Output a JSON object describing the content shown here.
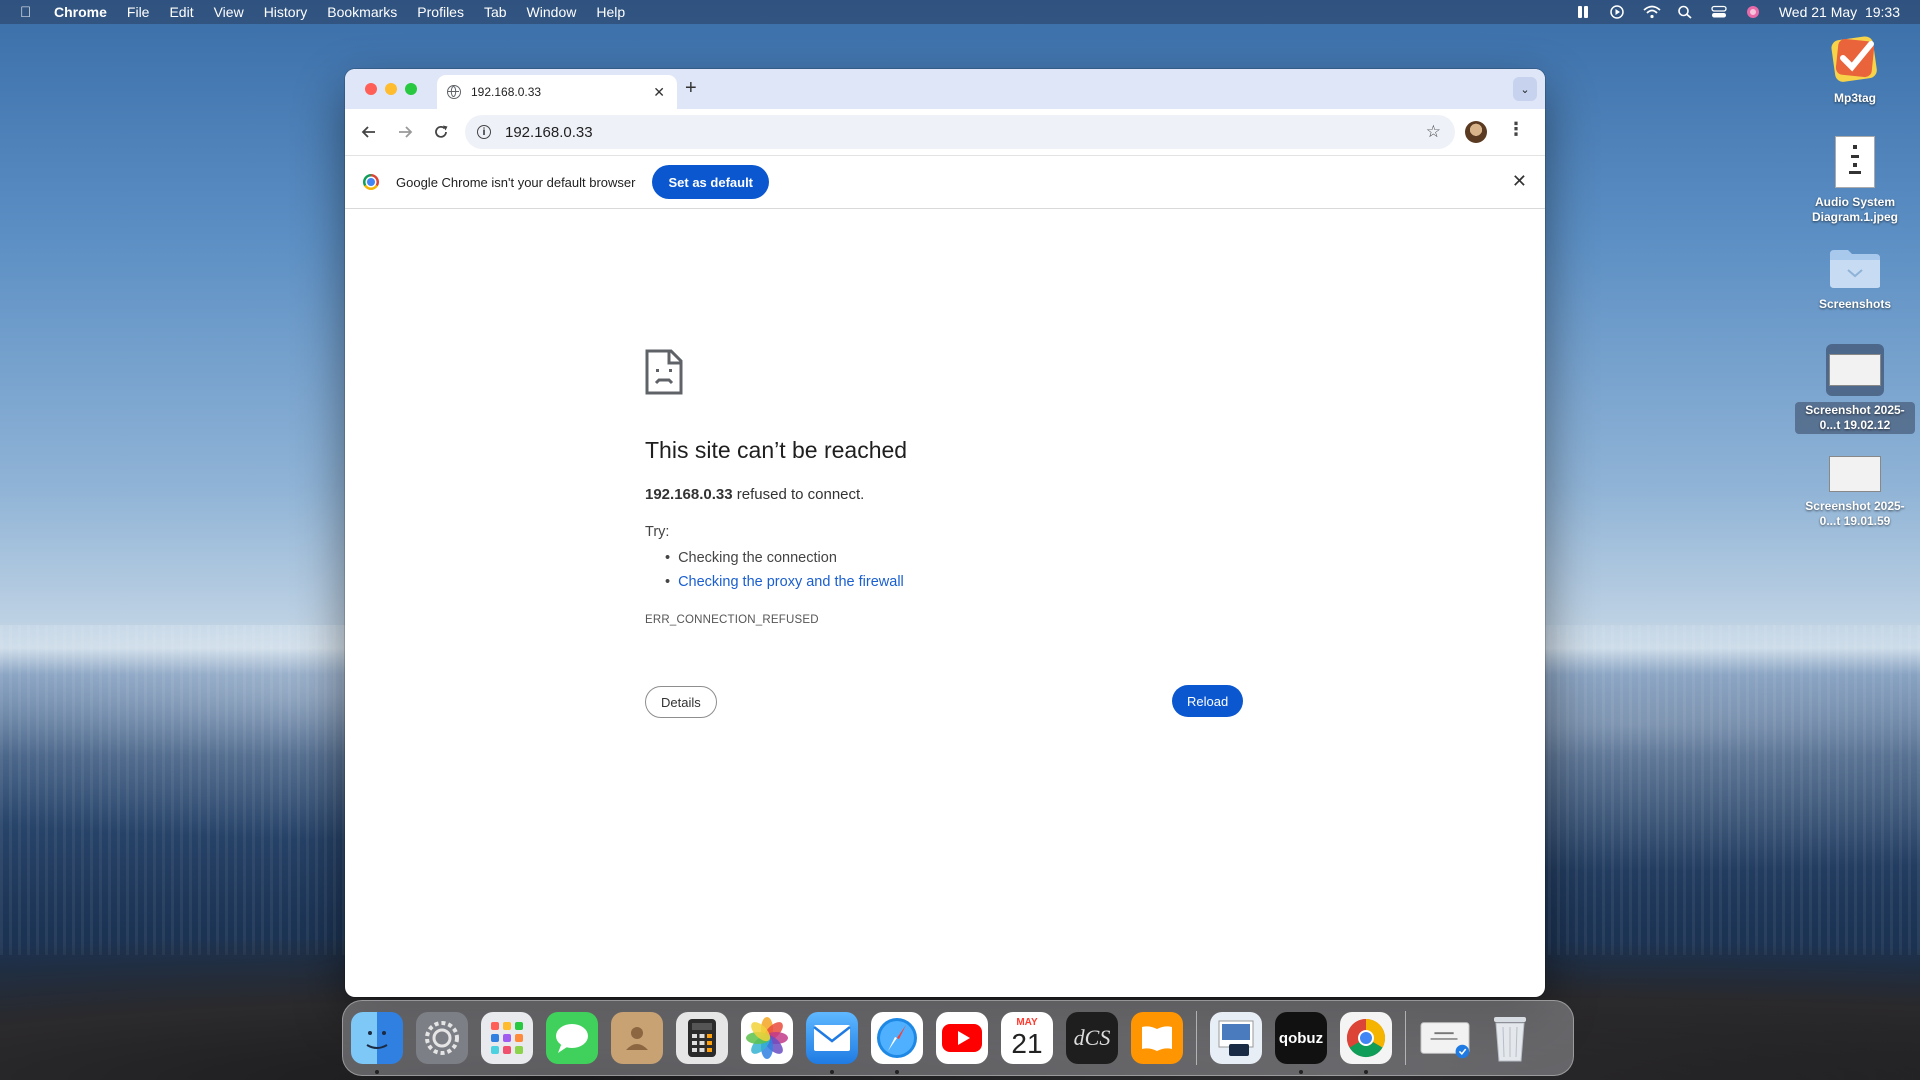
{
  "menubar": {
    "app": "Chrome",
    "items": [
      "File",
      "Edit",
      "View",
      "History",
      "Bookmarks",
      "Profiles",
      "Tab",
      "Window",
      "Help"
    ],
    "clock": "Wed 21 May  19:33"
  },
  "desktop": {
    "items": [
      {
        "label": "Mp3tag",
        "icon": "mp3tag-icon"
      },
      {
        "label": "Audio System Diagram.1.jpeg",
        "icon": "jpeg-file-icon"
      },
      {
        "label": "Screenshots",
        "icon": "folder-icon"
      },
      {
        "label": "Screenshot 2025-0...t 19.02.12",
        "icon": "screenshot-thumbnail"
      },
      {
        "label": "Screenshot 2025-0...t 19.01.59",
        "icon": "screenshot-thumbnail"
      }
    ]
  },
  "browser": {
    "tab_title": "192.168.0.33",
    "url": "192.168.0.33",
    "infobar": {
      "message": "Google Chrome isn't your default browser",
      "button": "Set as default"
    },
    "error": {
      "title": "This site can’t be reached",
      "host": "192.168.0.33",
      "host_suffix": " refused to connect.",
      "try_label": "Try:",
      "suggestions": [
        "Checking the connection",
        "Checking the proxy and the firewall"
      ],
      "code": "ERR_CONNECTION_REFUSED",
      "details_button": "Details",
      "reload_button": "Reload"
    }
  },
  "dock": {
    "apps": [
      "Finder",
      "System Settings",
      "Launchpad",
      "Messages",
      "Contacts",
      "Calculator",
      "Photos",
      "Mail",
      "Safari",
      "YouTube",
      "Calendar",
      "dCS",
      "Books",
      "Preview",
      "qobuz",
      "Chrome",
      "Downloads",
      "Trash"
    ],
    "calendar_month": "MAY",
    "calendar_day": "21",
    "dcs_label": "dCS",
    "qobuz_label": "qobuz"
  },
  "colors": {
    "accent": "#0b57d0",
    "link": "#1a5fd0",
    "tabstrip": "#dfe6f7"
  }
}
